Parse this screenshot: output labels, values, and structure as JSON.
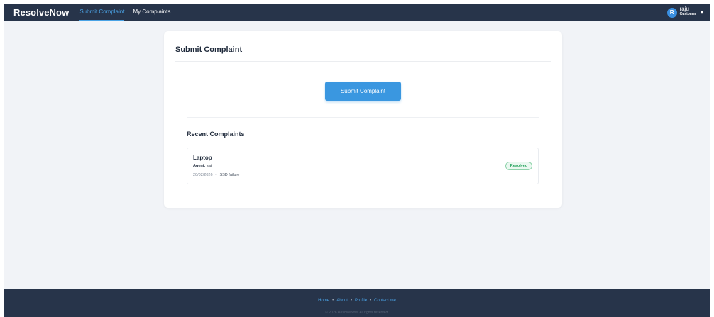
{
  "navbar": {
    "brand": "ResolveNow",
    "links": [
      {
        "label": "Submit Complaint",
        "active": true
      },
      {
        "label": "My Complaints",
        "active": false
      }
    ],
    "user": {
      "avatar_letter": "R",
      "name": "raju",
      "role": "Customer",
      "caret": "▾"
    }
  },
  "card": {
    "title": "Submit Complaint",
    "submit_label": "Submit Complaint",
    "recent_title": "Recent Complaints",
    "complaints": [
      {
        "title": "Laptop",
        "agent_label": "Agent:",
        "agent": "sai",
        "date": "20/02/2026",
        "issue": "SSD failure",
        "status": "Resolved"
      }
    ]
  },
  "footer": {
    "links": [
      "Home",
      "About",
      "Profile",
      "Contact me"
    ],
    "separator": "•",
    "copyright": "© 2026 ResolveNow. All rights reserved."
  },
  "colors": {
    "navbar_bg": "#27344a",
    "accent": "#3a97e0",
    "page_bg": "#f1f3f7",
    "status_resolved": "#26a35c"
  }
}
